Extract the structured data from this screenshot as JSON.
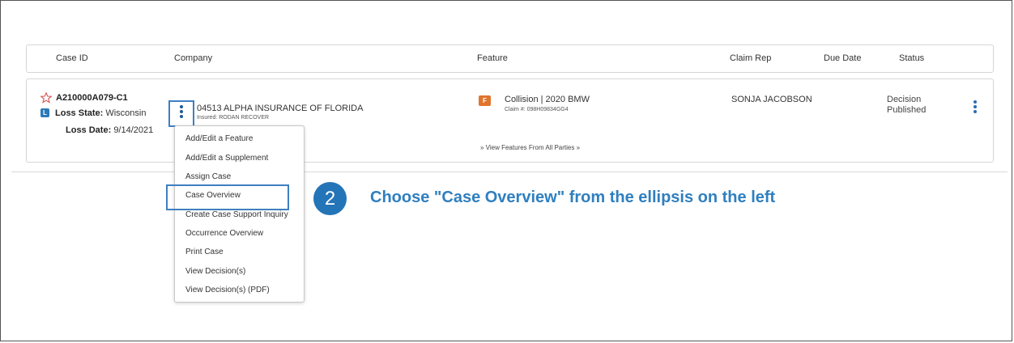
{
  "colors": {
    "accent": "#3f7fc0",
    "badge_l": "#2a7ab8",
    "badge_f": "#e0752d",
    "instruction": "#2f7fbf",
    "step": "#2474b8"
  },
  "header": {
    "case_id": "Case ID",
    "company": "Company",
    "feature": "Feature",
    "claim_rep": "Claim Rep",
    "due_date": "Due Date",
    "status": "Status"
  },
  "row": {
    "case_id": "A210000A079-C1",
    "l_badge": "L",
    "loss_state_label": "Loss State:",
    "loss_state": "Wisconsin",
    "loss_date_label": "Loss Date:",
    "loss_date": "9/14/2021",
    "company": "04513 ALPHA INSURANCE OF FLORIDA",
    "insured": "Insured: RODAN RECOVER",
    "f_badge": "F",
    "feature": "Collision | 2020 BMW",
    "claim_no": "Claim #: 098H09834GG4",
    "view_features": "» View Features From All Parties »",
    "claim_rep": "SONJA JACOBSON",
    "status_line1": "Decision",
    "status_line2": "Published"
  },
  "menu": {
    "items": [
      "Add/Edit a Feature",
      "Add/Edit a Supplement",
      "Assign Case",
      "Case Overview",
      "Create Case Support Inquiry",
      "Occurrence Overview",
      "Print Case",
      "View Decision(s)",
      "View Decision(s) (PDF)"
    ]
  },
  "callout": {
    "step": "2",
    "text": "Choose \"Case Overview\" from the ellipsis on the left"
  },
  "icons": [
    "star-icon",
    "vertical-ellipsis-icon",
    "double-chevron-down-icon"
  ]
}
